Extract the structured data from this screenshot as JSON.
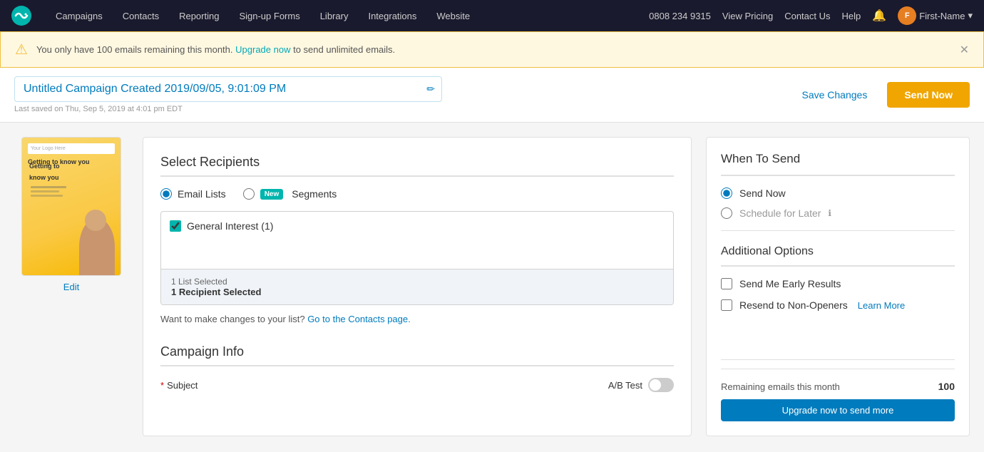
{
  "nav": {
    "logo_icon": "fish-icon",
    "links": [
      {
        "id": "campaigns",
        "label": "Campaigns"
      },
      {
        "id": "contacts",
        "label": "Contacts"
      },
      {
        "id": "reporting",
        "label": "Reporting"
      },
      {
        "id": "signup-forms",
        "label": "Sign-up Forms"
      },
      {
        "id": "library",
        "label": "Library"
      },
      {
        "id": "integrations",
        "label": "Integrations"
      },
      {
        "id": "website",
        "label": "Website"
      }
    ],
    "phone": "0808 234 9315",
    "view_pricing": "View Pricing",
    "contact_us": "Contact Us",
    "help": "Help",
    "user_name": "First-Name"
  },
  "banner": {
    "text_before": "You only have 100 emails remaining this month.",
    "link_text": "Upgrade now",
    "text_after": "to send unlimited emails."
  },
  "header": {
    "campaign_title": "Untitled Campaign Created 2019/09/05, 9:01:09 PM",
    "last_saved": "Last saved on Thu, Sep 5, 2019 at 4:01 pm EDT",
    "save_changes_label": "Save Changes",
    "send_now_label": "Send Now"
  },
  "preview": {
    "edit_label": "Edit",
    "logo_text": "Your Logo Here",
    "title_text": "Getting to know you",
    "subtitle_text": ""
  },
  "select_recipients": {
    "section_title": "Select Recipients",
    "radio_email_lists": "Email Lists",
    "radio_segments": "Segments",
    "new_badge": "New",
    "list_items": [
      {
        "id": "general-interest",
        "label": "General Interest (1)",
        "checked": true
      }
    ],
    "footer_top": "1 List Selected",
    "footer_bottom": "1 Recipient Selected",
    "contacts_text": "Want to make changes to your list?",
    "contacts_link_text": "Go to the Contacts page.",
    "contacts_link_href": "#"
  },
  "campaign_info": {
    "section_title": "Campaign Info",
    "subject_label": "*",
    "subject_text": "Subject",
    "ab_test_label": "A/B Test"
  },
  "when_to_send": {
    "title": "When To Send",
    "option_send_now": "Send Now",
    "option_schedule_later": "Schedule for Later",
    "info_icon": "ℹ"
  },
  "additional_options": {
    "title": "Additional Options",
    "option_early_results": "Send Me Early Results",
    "option_non_openers": "Resend to Non-Openers",
    "learn_more_label": "Learn More"
  },
  "footer_info": {
    "remaining_label": "Remaining emails this month",
    "remaining_count": "100",
    "upgrade_button": "Upgrade now to send more"
  }
}
